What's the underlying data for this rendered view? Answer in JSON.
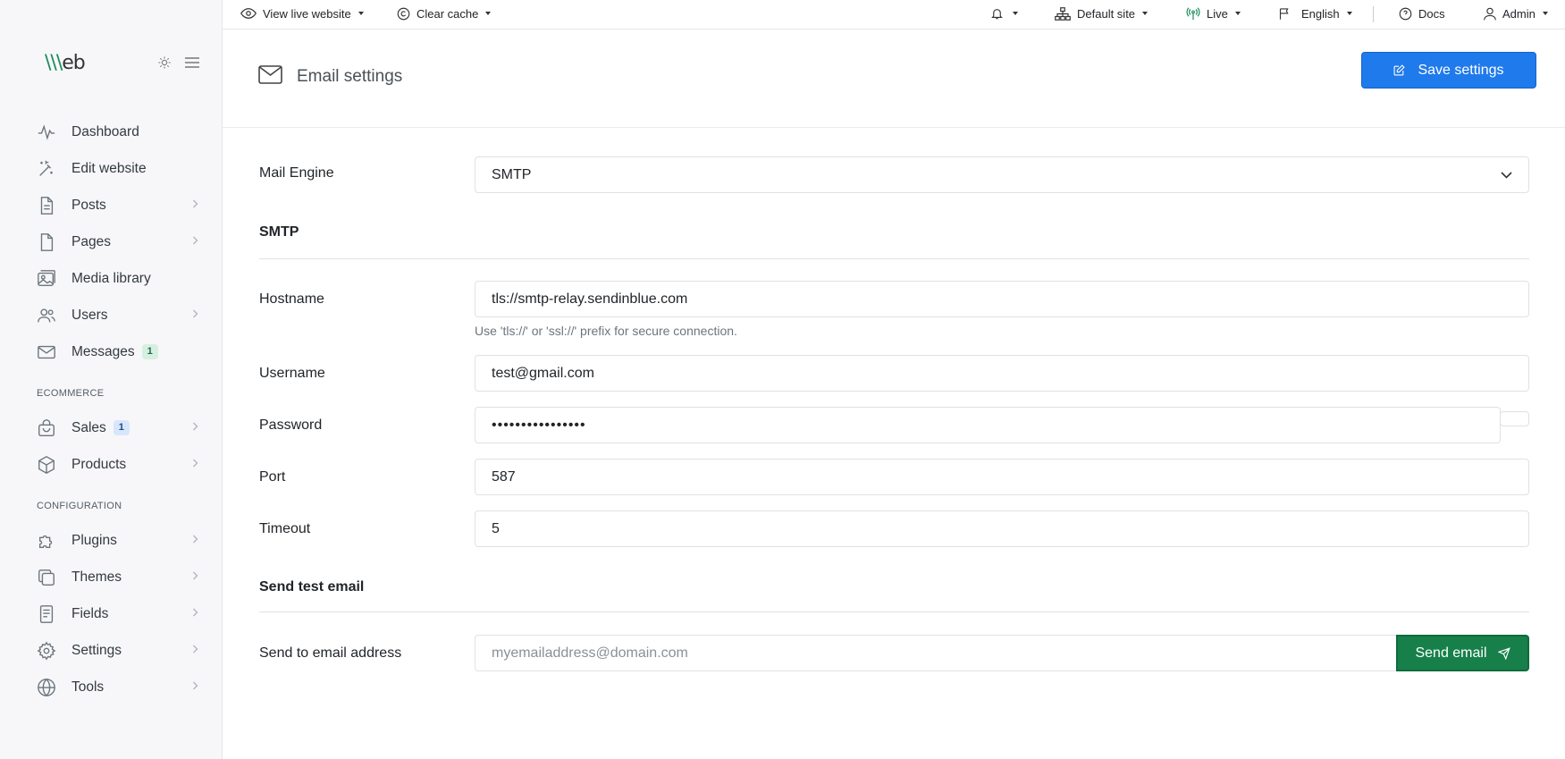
{
  "sidebar": {
    "logo": {
      "accent": "\\\\\\",
      "rest": "eb"
    },
    "items": [
      {
        "label": "Dashboard",
        "icon": "pulse-icon"
      },
      {
        "label": "Edit website",
        "icon": "magic-wand-icon"
      },
      {
        "label": "Posts",
        "icon": "document-icon"
      },
      {
        "label": "Pages",
        "icon": "file-icon"
      },
      {
        "label": "Media library",
        "icon": "images-icon"
      },
      {
        "label": "Users",
        "icon": "users-icon"
      },
      {
        "label": "Messages",
        "icon": "mail-icon",
        "badge": "1"
      }
    ],
    "ecommerce_heading": "ECOMMERCE",
    "ecommerce": [
      {
        "label": "Sales",
        "icon": "shopping-bag-icon",
        "badge": "1"
      },
      {
        "label": "Products",
        "icon": "box-icon"
      }
    ],
    "configuration_heading": "CONFIGURATION",
    "configuration": [
      {
        "label": "Plugins",
        "icon": "puzzle-icon"
      },
      {
        "label": "Themes",
        "icon": "layers-icon"
      },
      {
        "label": "Fields",
        "icon": "form-icon"
      },
      {
        "label": "Settings",
        "icon": "gear-icon"
      },
      {
        "label": "Tools",
        "icon": "globe-icon"
      }
    ]
  },
  "topbar": {
    "view_live": "View live website",
    "clear_cache": "Clear cache",
    "site": "Default site",
    "state": "Live",
    "language": "English",
    "docs": "Docs",
    "user": "Admin"
  },
  "header": {
    "title": "Email settings",
    "save_label": "Save settings"
  },
  "form": {
    "mail_engine": {
      "label": "Mail Engine",
      "value": "SMTP"
    },
    "smtp_section": "SMTP",
    "hostname": {
      "label": "Hostname",
      "value": "tls://smtp-relay.sendinblue.com",
      "help": "Use 'tls://' or 'ssl://' prefix for secure connection."
    },
    "username": {
      "label": "Username",
      "value": "test@gmail.com"
    },
    "password": {
      "label": "Password",
      "value": "••••••••••••••••"
    },
    "port": {
      "label": "Port",
      "value": "587"
    },
    "timeout": {
      "label": "Timeout",
      "value": "5"
    },
    "test_section": "Send test email",
    "send_to": {
      "label": "Send to email address",
      "placeholder": "myemailaddress@domain.com",
      "button": "Send email"
    }
  },
  "colors": {
    "primary": "#1f7aec",
    "success": "#17804a",
    "sidebar_bg": "#f7f7f9"
  }
}
